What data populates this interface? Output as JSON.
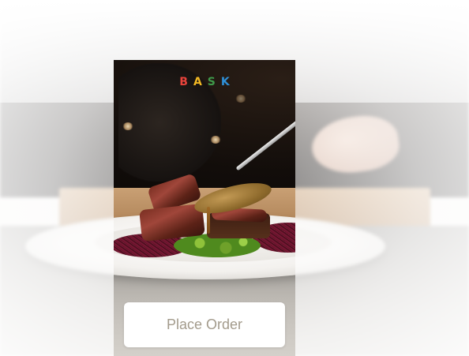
{
  "brand": {
    "letters": [
      {
        "char": "B",
        "color": "#e8433b"
      },
      {
        "char": "A",
        "color": "#f2b824"
      },
      {
        "char": "S",
        "color": "#3f9a4a"
      },
      {
        "char": "K",
        "color": "#2f8fd6"
      }
    ]
  },
  "actions": {
    "place_order_label": "Place Order"
  },
  "colors": {
    "button_bg": "#ffffff",
    "button_text": "#a39b8c",
    "background": "#f4f2ef"
  },
  "images": {
    "hero": "plated-steak-with-red-cabbage-and-greens"
  }
}
